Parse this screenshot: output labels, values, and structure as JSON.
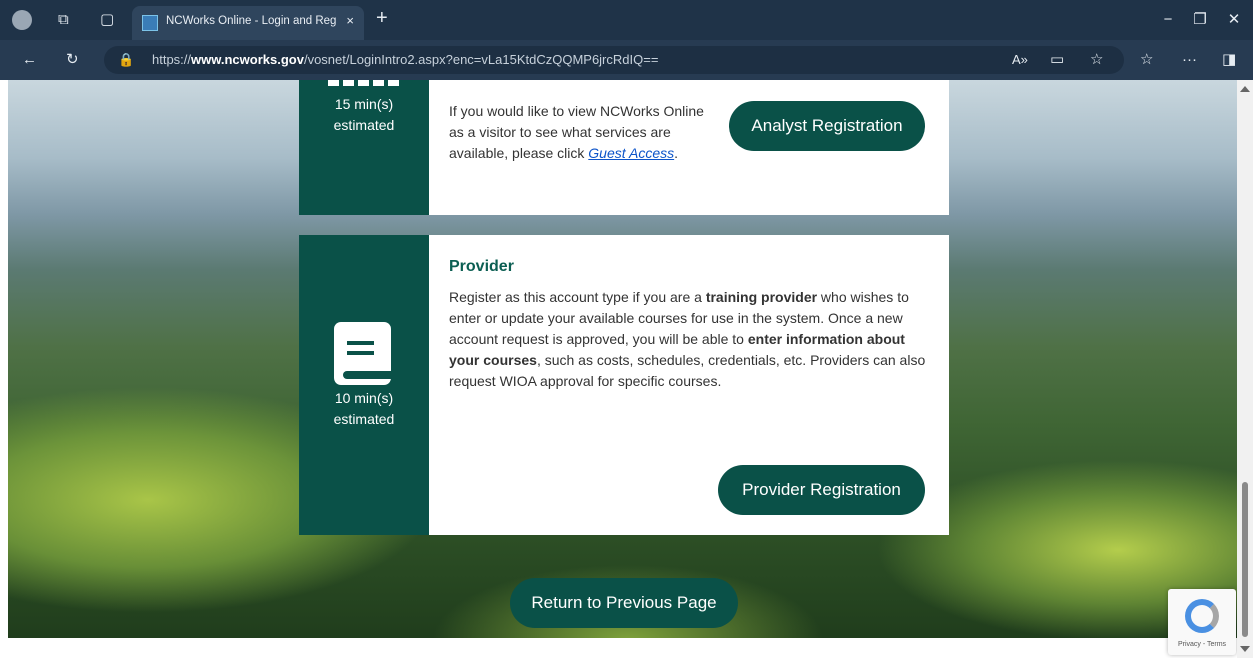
{
  "browser": {
    "tab_title": "NCWorks Online - Login and Regi",
    "tab_close": "×",
    "new_tab": "+",
    "url_prefix": "https://",
    "url_domain": "www.ncworks.gov",
    "url_path": "/vosnet/LoginIntro2.aspx?enc=vLa15KtdCzQQMP6jrcRdIQ==",
    "window_controls": [
      "−",
      "❐",
      "✕"
    ]
  },
  "cards": {
    "analyst": {
      "time": "15 min(s)",
      "estimated": "estimated",
      "text_before": "If you would like to view NCWorks Online as a visitor to see what services are available, please click ",
      "link": "Guest Access",
      "text_after": ".",
      "button": "Analyst Registration"
    },
    "provider": {
      "title": "Provider",
      "time": "10 min(s)",
      "estimated": "estimated",
      "p1": "Register as this account type if you are a ",
      "b1": "training provider",
      "p2": " who wishes to enter or update your available courses for use in the system. Once a new account request is approved, you will be able to ",
      "b2": "enter information about your courses",
      "p3": ", such as costs, schedules, credentials, etc. Providers can also request WIOA approval for specific courses.",
      "button": "Provider Registration"
    }
  },
  "return_button": "Return to Previous Page",
  "recaptcha": "Privacy - Terms",
  "colors": {
    "accent": "#0a5148",
    "heading": "#0b5e52",
    "link": "#0c54c9"
  }
}
